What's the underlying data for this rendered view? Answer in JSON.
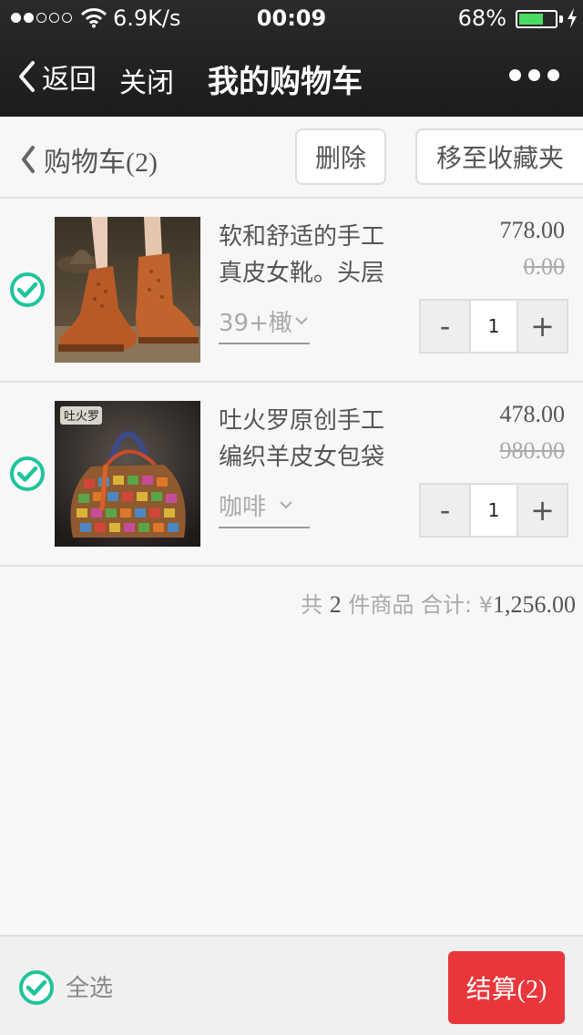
{
  "status_bar": {
    "speed": "6.9K/s",
    "time": "00:09",
    "battery_pct": "68%",
    "battery_level": 0.68
  },
  "nav": {
    "back_label": "返回",
    "close_label": "关闭",
    "title": "我的购物车"
  },
  "cart_header": {
    "title": "购物车(2)",
    "delete_label": "删除",
    "move_fav_label": "移至收藏夹"
  },
  "items": [
    {
      "name": "软和舒适的手工真皮女靴。头层",
      "variant": "39+橄",
      "price": "778.00",
      "original_price": "0.00",
      "quantity": "1",
      "checked": true
    },
    {
      "name": "吐火罗原创手工编织羊皮女包袋",
      "variant": "咖啡",
      "price": "478.00",
      "original_price": "980.00",
      "quantity": "1",
      "checked": true,
      "image_logo_text": "吐火罗"
    }
  ],
  "summary": {
    "prefix": "共",
    "count": "2",
    "mid": "件商品 合计: ¥",
    "total": "1,256.00"
  },
  "bottom": {
    "select_all_label": "全选",
    "checkout_label": "结算(2)"
  },
  "colors": {
    "accent_green": "#1fc49a",
    "checkout_red": "#e8363a"
  }
}
